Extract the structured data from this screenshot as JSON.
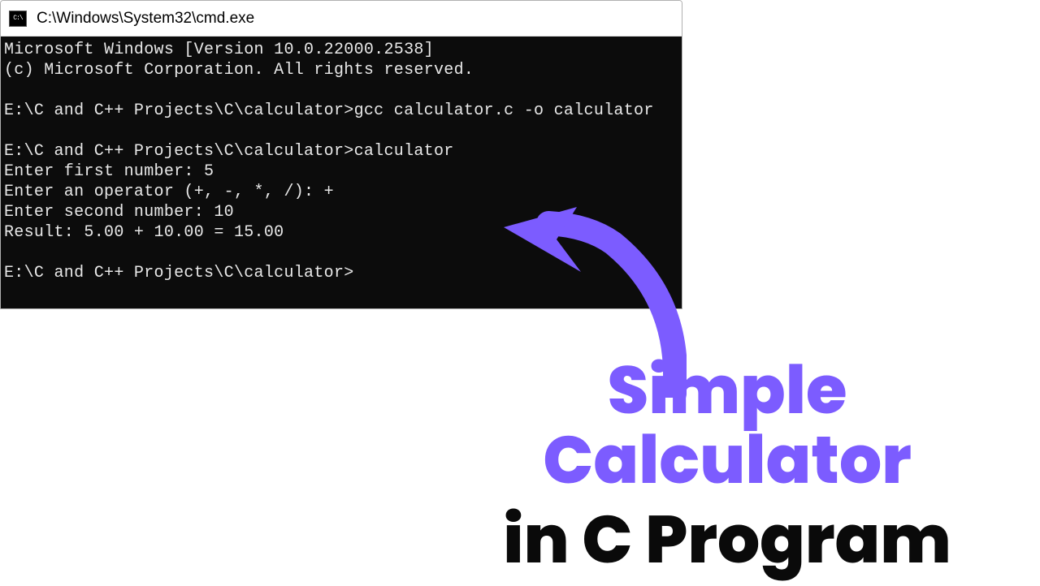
{
  "window": {
    "title": "C:\\Windows\\System32\\cmd.exe",
    "icon_label": "C:\\"
  },
  "terminal": {
    "line1": "Microsoft Windows [Version 10.0.22000.2538]",
    "line2": "(c) Microsoft Corporation. All rights reserved.",
    "blank1": "",
    "line3": "E:\\C and C++ Projects\\C\\calculator>gcc calculator.c -o calculator",
    "blank2": "",
    "line4": "E:\\C and C++ Projects\\C\\calculator>calculator",
    "line5": "Enter first number: 5",
    "line6": "Enter an operator (+, -, *, /): +",
    "line7": "Enter second number: 10",
    "line8": "Result: 5.00 + 10.00 = 15.00",
    "blank3": "",
    "line9": "E:\\C and C++ Projects\\C\\calculator>"
  },
  "heading": {
    "line1": "Simple Calculator",
    "line2": "in C Program"
  },
  "colors": {
    "accent": "#7c5cff"
  }
}
